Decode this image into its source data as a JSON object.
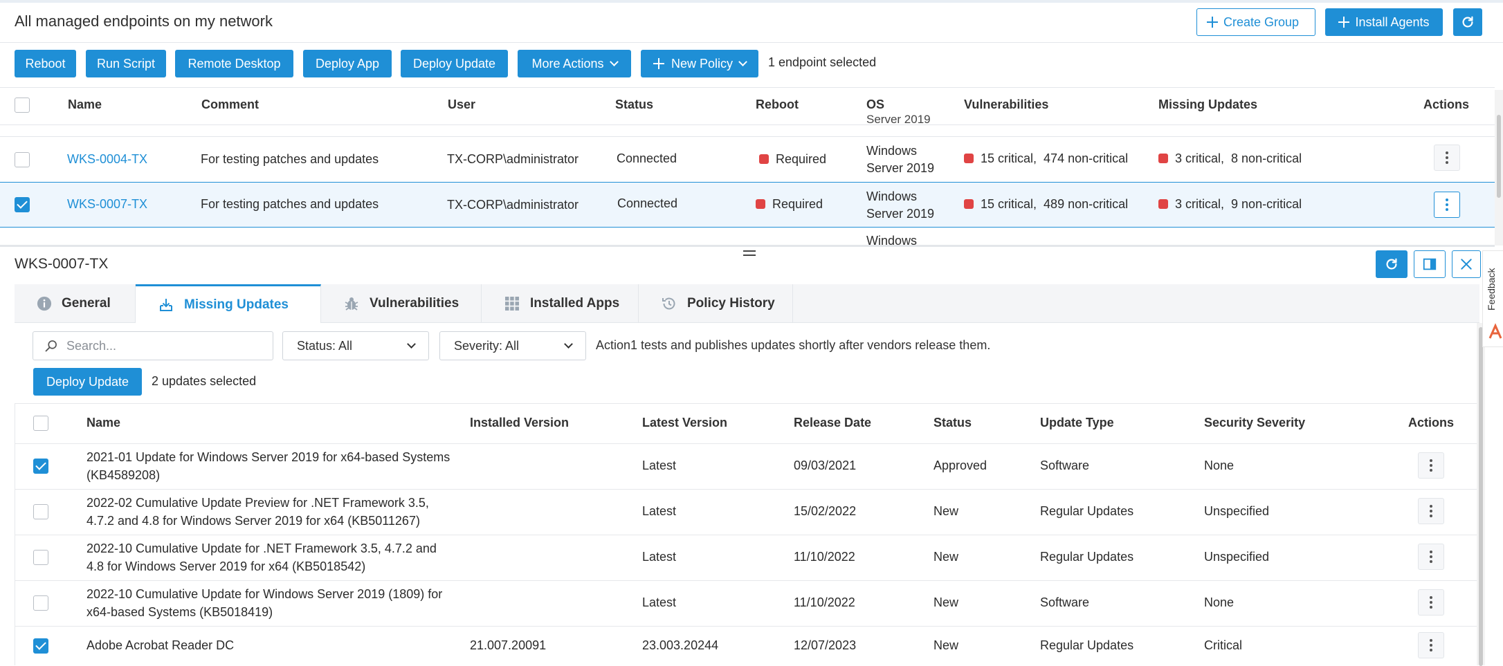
{
  "header": {
    "title": "All managed endpoints on my network",
    "create_group": "Create Group",
    "install_agents": "Install Agents"
  },
  "toolbar": {
    "reboot": "Reboot",
    "run_script": "Run Script",
    "remote_desktop": "Remote Desktop",
    "deploy_app": "Deploy App",
    "deploy_update": "Deploy Update",
    "more_actions": "More Actions",
    "new_policy": "New Policy",
    "selection": "1 endpoint selected"
  },
  "endpoints": {
    "columns": {
      "name": "Name",
      "comment": "Comment",
      "user": "User",
      "status": "Status",
      "reboot": "Reboot",
      "os": "OS",
      "vulnerabilities": "Vulnerabilities",
      "missing_updates": "Missing Updates",
      "actions": "Actions"
    },
    "partial_above_os": "Server 2019",
    "partial_below_os": "Windows",
    "rows": [
      {
        "name": "WKS-0004-TX",
        "comment": "For testing patches and updates",
        "user": "TX-CORP\\administrator",
        "status": "Connected",
        "reboot": "Required",
        "os_line1": "Windows",
        "os_line2": "Server 2019",
        "vuln_critical": "15 critical,",
        "vuln_noncritical": "474 non-critical",
        "upd_critical": "3 critical,",
        "upd_noncritical": "8 non-critical",
        "selected": false
      },
      {
        "name": "WKS-0007-TX",
        "comment": "For testing patches and updates",
        "user": "TX-CORP\\administrator",
        "status": "Connected",
        "reboot": "Required",
        "os_line1": "Windows",
        "os_line2": "Server 2019",
        "vuln_critical": "15 critical,",
        "vuln_noncritical": "489 non-critical",
        "upd_critical": "3 critical,",
        "upd_noncritical": "9 non-critical",
        "selected": true
      }
    ]
  },
  "panel": {
    "title": "WKS-0007-TX",
    "tabs": {
      "general": "General",
      "missing_updates": "Missing Updates",
      "vulnerabilities": "Vulnerabilities",
      "installed_apps": "Installed Apps",
      "policy_history": "Policy History"
    },
    "search_placeholder": "Search...",
    "status_filter": "Status: All",
    "severity_filter": "Severity: All",
    "info": "Action1 tests and publishes updates shortly after vendors release them.",
    "deploy_update": "Deploy Update",
    "selection": "2 updates selected",
    "feedback": "Feedback"
  },
  "updates": {
    "columns": {
      "name": "Name",
      "installed_version": "Installed Version",
      "latest_version": "Latest Version",
      "release_date": "Release Date",
      "status": "Status",
      "update_type": "Update Type",
      "security_severity": "Security Severity",
      "actions": "Actions"
    },
    "rows": [
      {
        "name": "2021-01 Update for Windows Server 2019 for x64-based Systems (KB4589208)",
        "installed": "",
        "latest": "Latest",
        "date": "09/03/2021",
        "status": "Approved",
        "type": "Software",
        "severity": "None",
        "selected": true
      },
      {
        "name": "2022-02 Cumulative Update Preview for .NET Framework 3.5, 4.7.2 and 4.8 for Windows Server 2019 for x64 (KB5011267)",
        "installed": "",
        "latest": "Latest",
        "date": "15/02/2022",
        "status": "New",
        "type": "Regular Updates",
        "severity": "Unspecified",
        "selected": false
      },
      {
        "name": "2022-10 Cumulative Update for .NET Framework 3.5, 4.7.2 and 4.8 for Windows Server 2019 for x64 (KB5018542)",
        "installed": "",
        "latest": "Latest",
        "date": "11/10/2022",
        "status": "New",
        "type": "Regular Updates",
        "severity": "Unspecified",
        "selected": false
      },
      {
        "name": "2022-10 Cumulative Update for Windows Server 2019 (1809) for x64-based Systems (KB5018419)",
        "installed": "",
        "latest": "Latest",
        "date": "11/10/2022",
        "status": "New",
        "type": "Software",
        "severity": "None",
        "selected": false
      },
      {
        "name": "Adobe Acrobat Reader DC",
        "installed": "21.007.20091",
        "latest": "23.003.20244",
        "date": "12/07/2023",
        "status": "New",
        "type": "Regular Updates",
        "severity": "Critical",
        "selected": true
      }
    ]
  },
  "colors": {
    "accent": "#1f8fd6",
    "danger": "#e04444"
  }
}
